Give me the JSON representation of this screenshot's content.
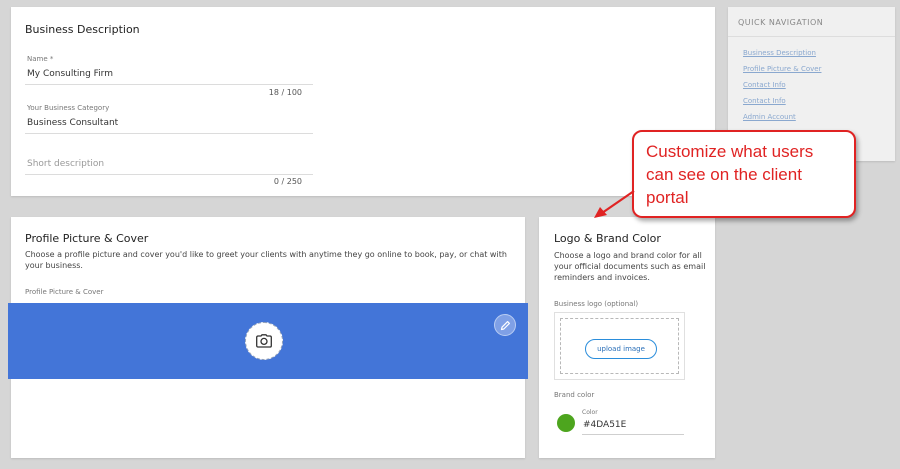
{
  "business_description": {
    "title": "Business Description",
    "name_label": "Name *",
    "name_value": "My Consulting Firm",
    "name_counter": "18 / 100",
    "category_label": "Your Business Category",
    "category_value": "Business Consultant",
    "short_desc_placeholder": "Short description",
    "short_desc_counter": "0 / 250"
  },
  "profile": {
    "title": "Profile Picture & Cover",
    "description": "Choose a profile picture and cover you'd like to greet your clients with anytime they go online to book, pay, or chat with your business.",
    "field_label": "Profile Picture & Cover",
    "cover_color": "#4375d8"
  },
  "logo": {
    "title": "Logo & Brand Color",
    "description": "Choose a logo and brand color for all your official documents such as email reminders and invoices.",
    "logo_label": "Business logo (optional)",
    "upload_button": "upload image",
    "brand_color_label": "Brand color",
    "color_label": "Color",
    "color_value": "#4DA51E"
  },
  "quick_navigation": {
    "title": "QUICK NAVIGATION",
    "items": [
      "Business Description",
      "Profile Picture & Cover",
      "Contact Info",
      "Contact Info",
      "Admin Account"
    ]
  },
  "callout": {
    "text": "Customize what users can see on the client portal",
    "color": "#e02323"
  }
}
